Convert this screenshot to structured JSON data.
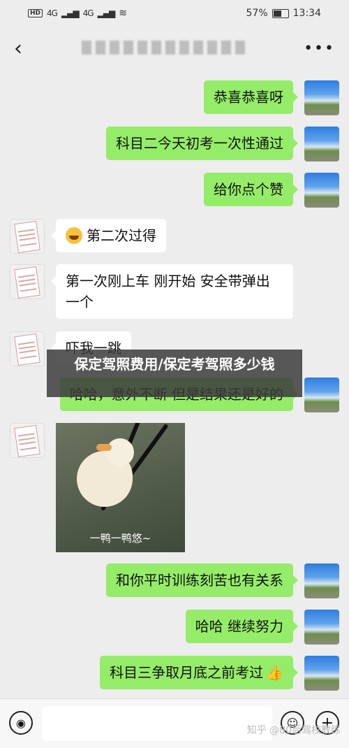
{
  "status": {
    "hd": "HD",
    "net1": "4G",
    "net2": "4G",
    "battery": "57%",
    "time": "13:34"
  },
  "header": {
    "back": "‹",
    "more": "•••"
  },
  "messages": [
    {
      "text": "恭喜恭喜呀"
    },
    {
      "text": "科目二今天初考一次性通过"
    },
    {
      "text": "给你点个赞"
    },
    {
      "text": "第二次过得"
    },
    {
      "text": "第一次刚上车 刚开始 安全带弹出一个"
    },
    {
      "text": "吓我一跳"
    },
    {
      "text": "哈哈，意外不断 但是结果还是好的"
    },
    {
      "text": "和你平时训练刻苦也有关系"
    },
    {
      "text": "哈哈 继续努力"
    },
    {
      "text": "科目三争取月底之前考过"
    }
  ],
  "sticker": {
    "caption": "一鸭一鸭悠~"
  },
  "overlay": {
    "text": "保定驾照费用/保定考驾照多少钱"
  },
  "watermark": {
    "text": "知乎 @80后驾校教练"
  },
  "icons": [
    "back-icon",
    "more-icon",
    "voice-icon",
    "emoji-icon",
    "plus-icon",
    "thumbs-up-icon"
  ]
}
